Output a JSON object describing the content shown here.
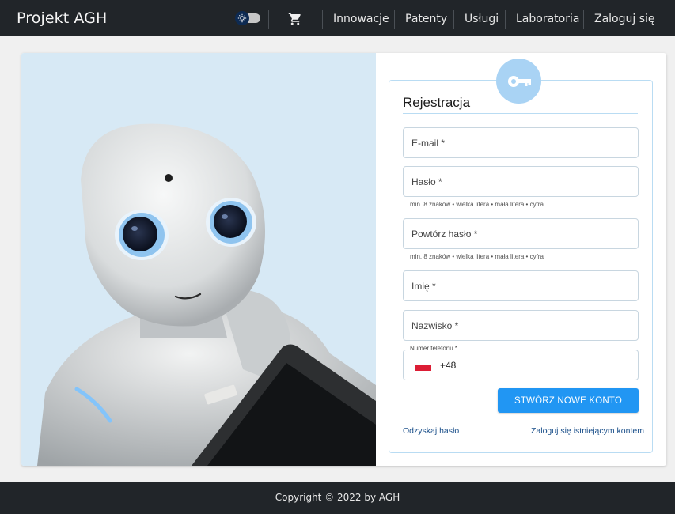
{
  "header": {
    "brand": "Projekt AGH",
    "nav": [
      "Innowacje",
      "Patenty",
      "Usługi",
      "Laboratoria",
      "Zaloguj się"
    ],
    "theme_toggle_icon": "sun-icon",
    "cart_icon": "cart-icon"
  },
  "form": {
    "title": "Rejestracja",
    "badge_icon": "key-icon",
    "email_label": "E-mail *",
    "password_label": "Hasło *",
    "password_hint": "min. 8 znaków • wielka litera • mała litera • cyfra",
    "repeat_password_label": "Powtórz hasło *",
    "repeat_password_hint": "min. 8 znaków • wielka litera • mała litera • cyfra",
    "first_name_label": "Imię *",
    "last_name_label": "Nazwisko *",
    "phone_label": "Numer telefonu *",
    "phone_prefix": "+48",
    "submit_label": "STWÓRZ NOWE KONTO",
    "recover_link": "Odzyskaj hasło",
    "login_link": "Zaloguj się istniejącym kontem"
  },
  "footer": {
    "copyright": "Copyright © 2022 by AGH"
  },
  "colors": {
    "header_bg": "#212529",
    "accent": "#2196f3",
    "badge": "#a9d3f4",
    "photo_bg": "#d7e9f5"
  }
}
